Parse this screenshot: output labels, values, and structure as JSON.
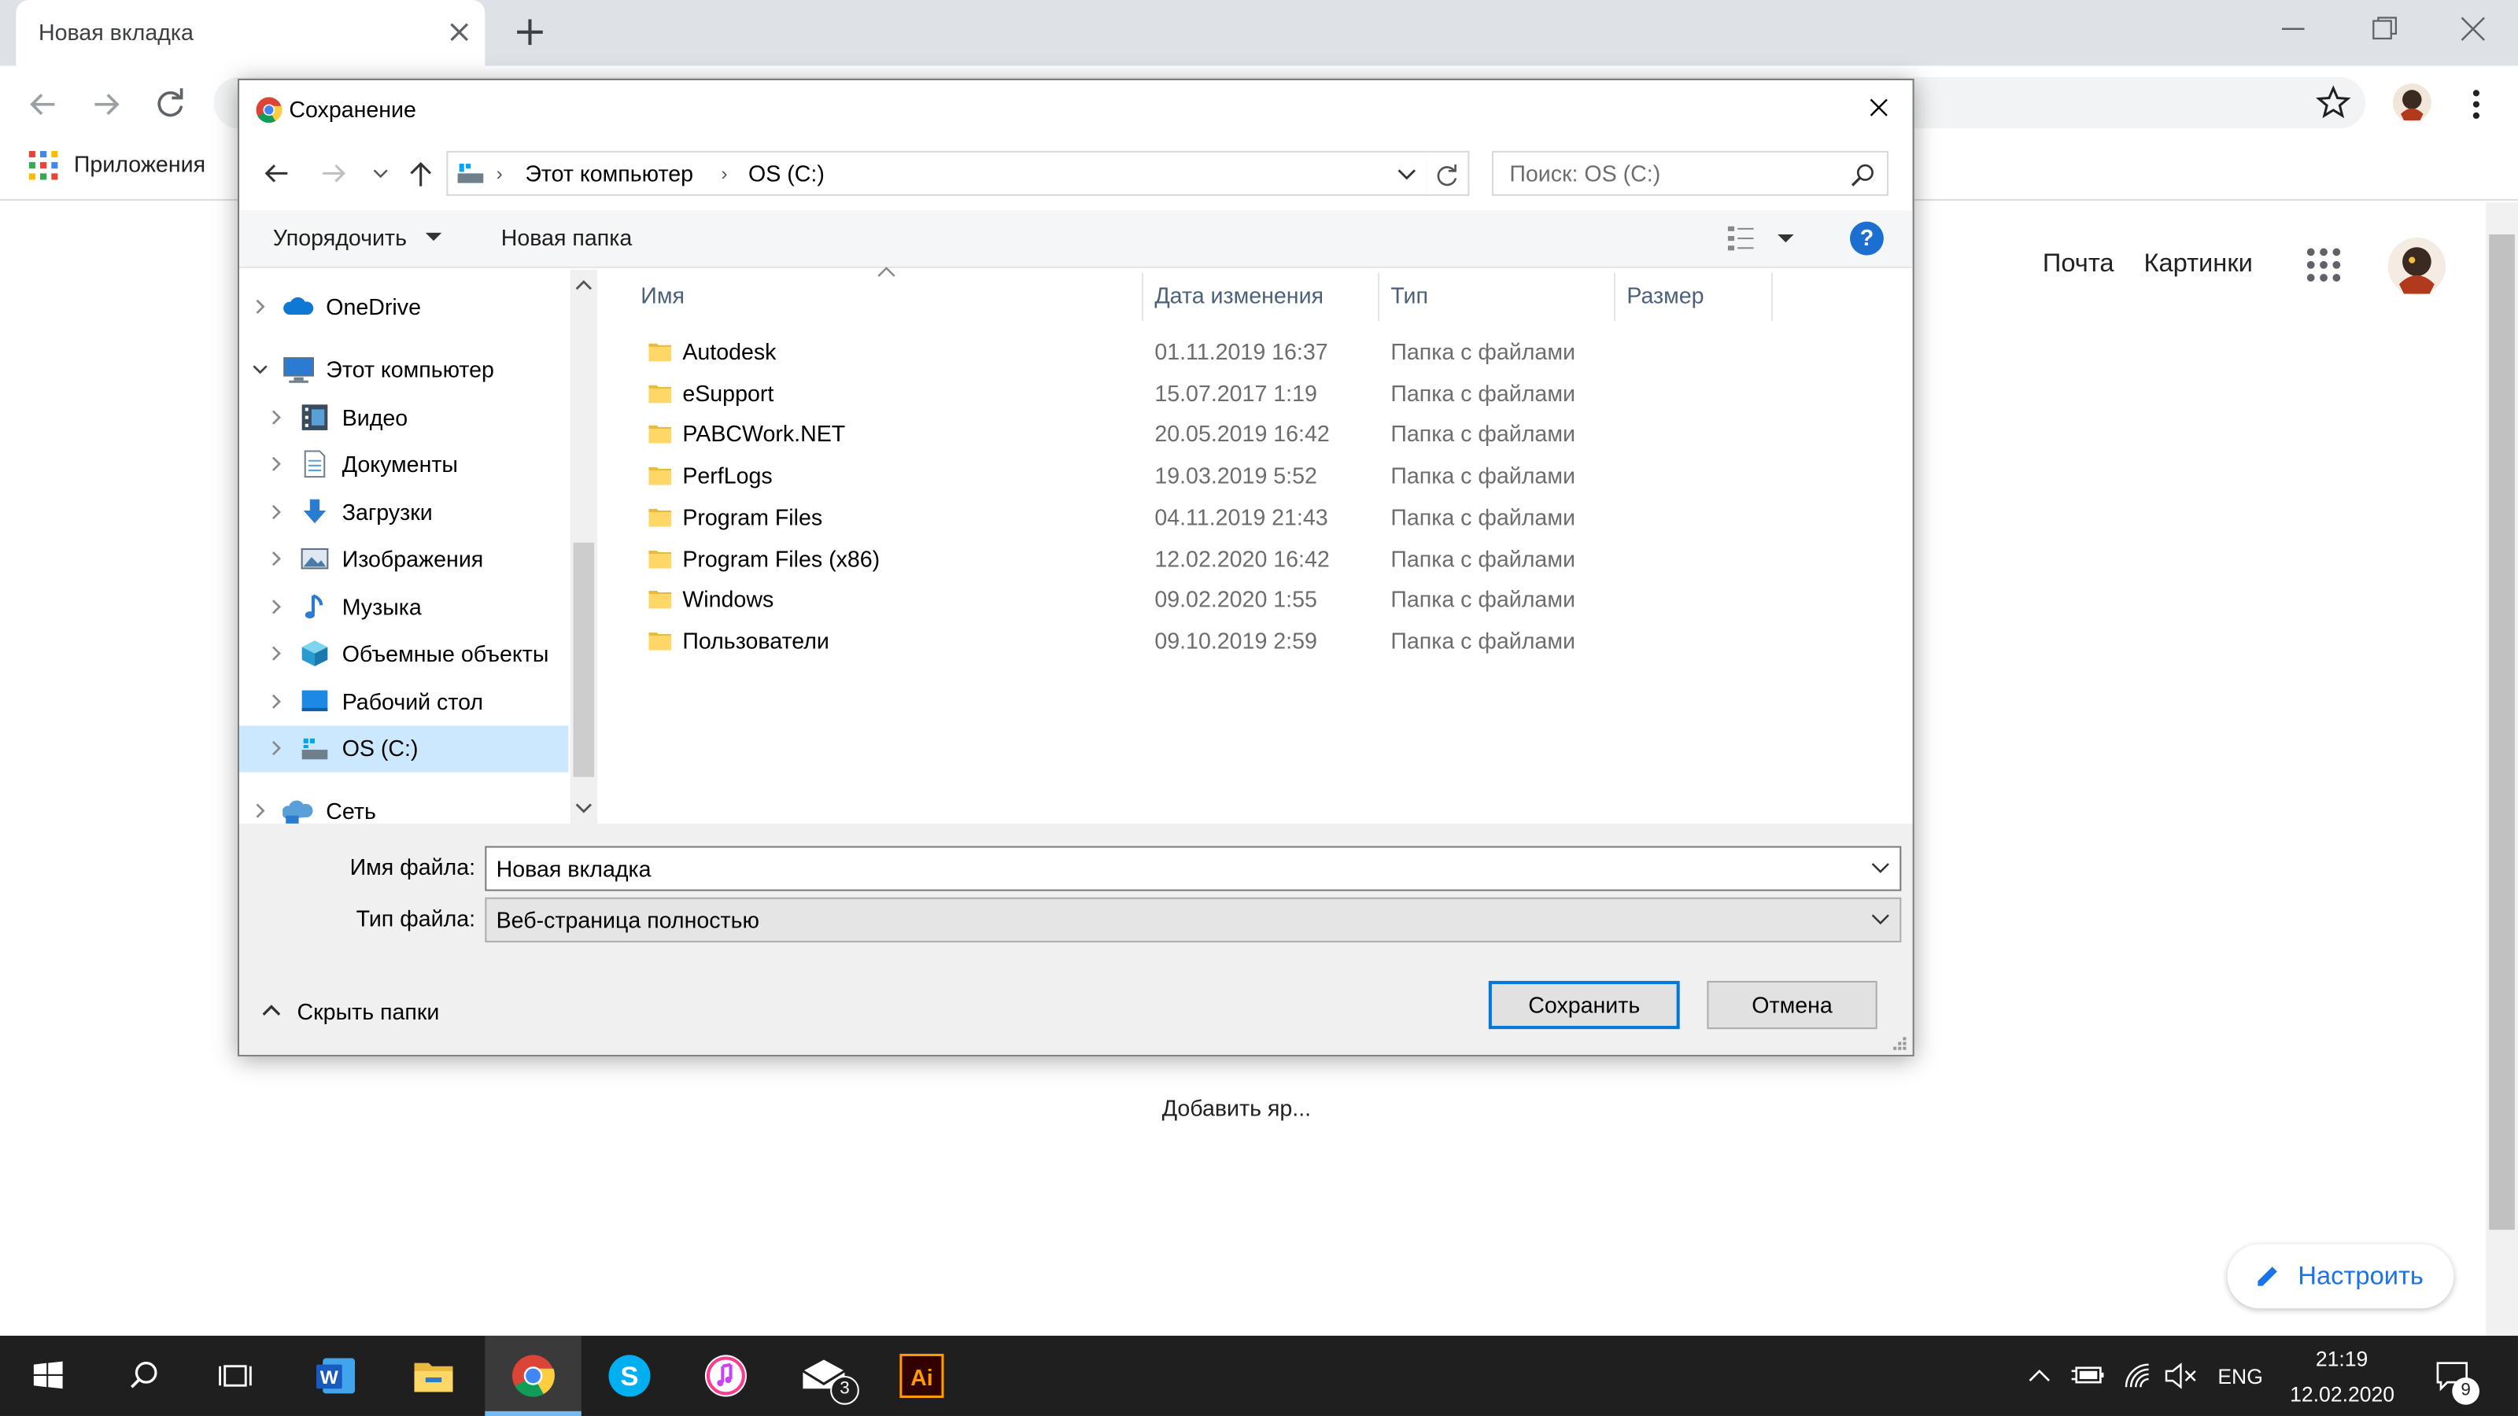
{
  "browser": {
    "tab_title": "Новая вкладка",
    "bookmarks_label": "Приложения",
    "google_links": [
      "Почта",
      "Картинки"
    ],
    "add_shortcut": "Добавить яр...",
    "customize_label": "Настроить"
  },
  "dialog": {
    "title": "Сохранение",
    "breadcrumb": [
      "Этот компьютер",
      "OS (C:)"
    ],
    "search_placeholder": "Поиск: OS (C:)",
    "toolbar": {
      "organize": "Упорядочить",
      "new_folder": "Новая папка",
      "help": "?"
    },
    "nav_items": [
      {
        "label": "OneDrive",
        "icon": "onedrive-cloud-icon"
      },
      {
        "label": "Этот компьютер",
        "icon": "computer-icon"
      },
      {
        "label": "Видео",
        "icon": "video-folder-icon"
      },
      {
        "label": "Документы",
        "icon": "documents-icon"
      },
      {
        "label": "Загрузки",
        "icon": "downloads-arrow-icon"
      },
      {
        "label": "Изображения",
        "icon": "pictures-icon"
      },
      {
        "label": "Музыка",
        "icon": "music-note-icon"
      },
      {
        "label": "Объемные объекты",
        "icon": "3d-objects-icon"
      },
      {
        "label": "Рабочий стол",
        "icon": "desktop-icon"
      },
      {
        "label": "OS (C:)",
        "icon": "drive-icon"
      },
      {
        "label": "Сеть",
        "icon": "network-icon"
      }
    ],
    "columns": [
      "Имя",
      "Дата изменения",
      "Тип",
      "Размер"
    ],
    "files": [
      {
        "name": "Autodesk",
        "date": "01.11.2019 16:37",
        "type": "Папка с файлами"
      },
      {
        "name": "eSupport",
        "date": "15.07.2017 1:19",
        "type": "Папка с файлами"
      },
      {
        "name": "PABCWork.NET",
        "date": "20.05.2019 16:42",
        "type": "Папка с файлами"
      },
      {
        "name": "PerfLogs",
        "date": "19.03.2019 5:52",
        "type": "Папка с файлами"
      },
      {
        "name": "Program Files",
        "date": "04.11.2019 21:43",
        "type": "Папка с файлами"
      },
      {
        "name": "Program Files (x86)",
        "date": "12.02.2020 16:42",
        "type": "Папка с файлами"
      },
      {
        "name": "Windows",
        "date": "09.02.2020 1:55",
        "type": "Папка с файлами"
      },
      {
        "name": "Пользователи",
        "date": "09.10.2019 2:59",
        "type": "Папка с файлами"
      }
    ],
    "filename_label": "Имя файла:",
    "filename_value": "Новая вкладка",
    "filetype_label": "Тип файла:",
    "filetype_value": "Веб-страница полностью",
    "hide_folders": "Скрыть папки",
    "save_button": "Сохранить",
    "cancel_button": "Отмена"
  },
  "taskbar": {
    "mail_badge": "3",
    "language": "ENG",
    "time": "21:19",
    "date": "12.02.2020",
    "notifications_count": "9",
    "apps": [
      "start-icon",
      "search-icon",
      "task-view-icon",
      "word-icon",
      "file-explorer-icon",
      "chrome-icon",
      "skype-icon",
      "itunes-icon",
      "mail-icon",
      "illustrator-icon"
    ]
  },
  "colors": {
    "accent": "#0078d7",
    "selection": "#cce8ff",
    "taskbar": "#1f1f1f",
    "folder": "#ffd766"
  }
}
